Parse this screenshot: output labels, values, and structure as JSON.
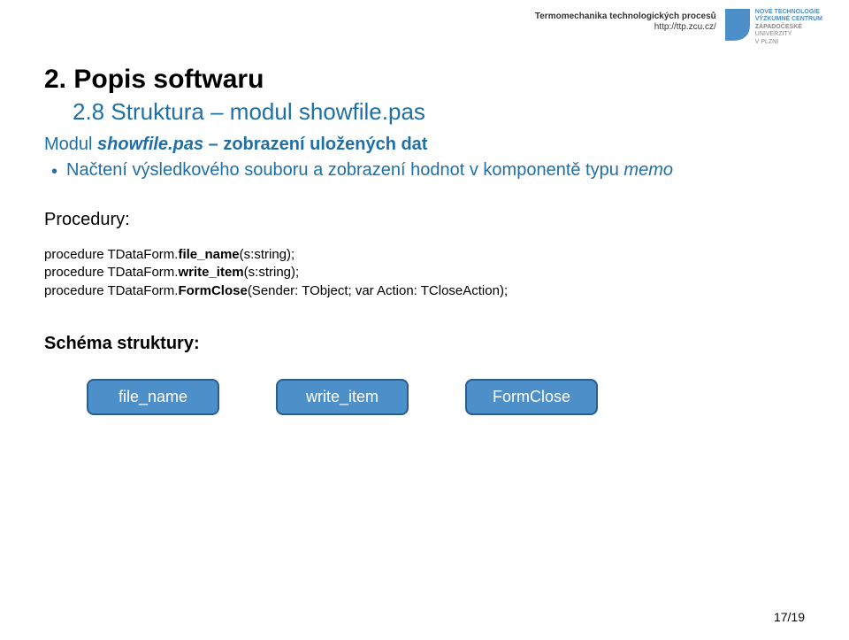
{
  "header": {
    "line1": "Termomechanika technologických procesů",
    "line2": "http://ttp.zcu.cz/",
    "logo": {
      "l1": "NOVÉ TECHNOLOGIE",
      "l2": "VÝZKUMNÉ CENTRUM",
      "l3": "ZÁPADOČESKÉ",
      "l4": "UNIVERZITY",
      "l5": "V PLZNI"
    }
  },
  "section": {
    "number": "2.",
    "title": "Popis softwaru",
    "sub_number": "2.8",
    "sub_title": "Struktura – modul showfile.pas"
  },
  "module": {
    "label": "Modul",
    "name": "showfile.pas",
    "desc": " – zobrazení uložených dat"
  },
  "bullet": {
    "text_pre": "Načtení výsledkového souboru a zobrazení hodnot v komponentě typu ",
    "memo": "memo"
  },
  "procedures": {
    "label": "Procedury:",
    "items": [
      {
        "pre": "procedure TDataForm.",
        "bold": "file_name",
        "post": "(s:string);"
      },
      {
        "pre": "procedure TDataForm.",
        "bold": "write_item",
        "post": "(s:string);"
      },
      {
        "pre": "procedure TDataForm.",
        "bold": "FormClose",
        "post": "(Sender: TObject; var Action: TCloseAction);"
      }
    ]
  },
  "schema": {
    "label": "Schéma struktury:",
    "boxes": [
      "file_name",
      "write_item",
      "FormClose"
    ]
  },
  "page": "17/19"
}
